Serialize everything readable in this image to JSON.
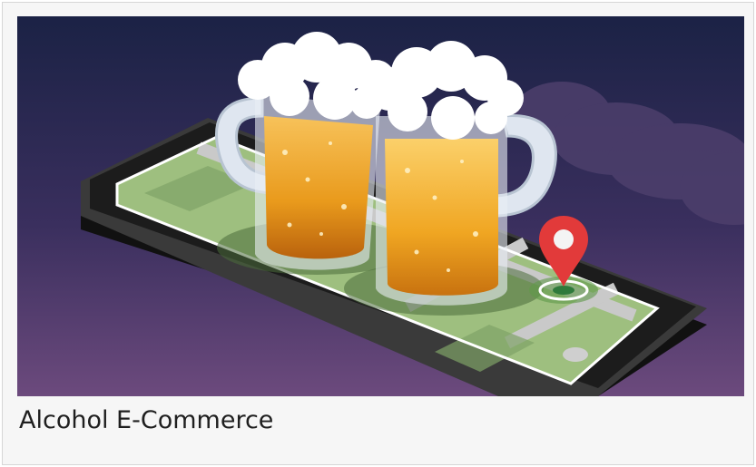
{
  "card": {
    "title": "Alcohol E-Commerce"
  },
  "illustration": {
    "icon": "beer-mugs-on-phone-map-illustration",
    "colors": {
      "sky_top": "#1b2245",
      "sky_bottom": "#6c4a7d",
      "beer": "#f0a622",
      "foam": "#ffffff",
      "map_green": "#9ebf7f",
      "pin_red": "#e23a3a",
      "phone_body": "#1c1c1c"
    }
  }
}
